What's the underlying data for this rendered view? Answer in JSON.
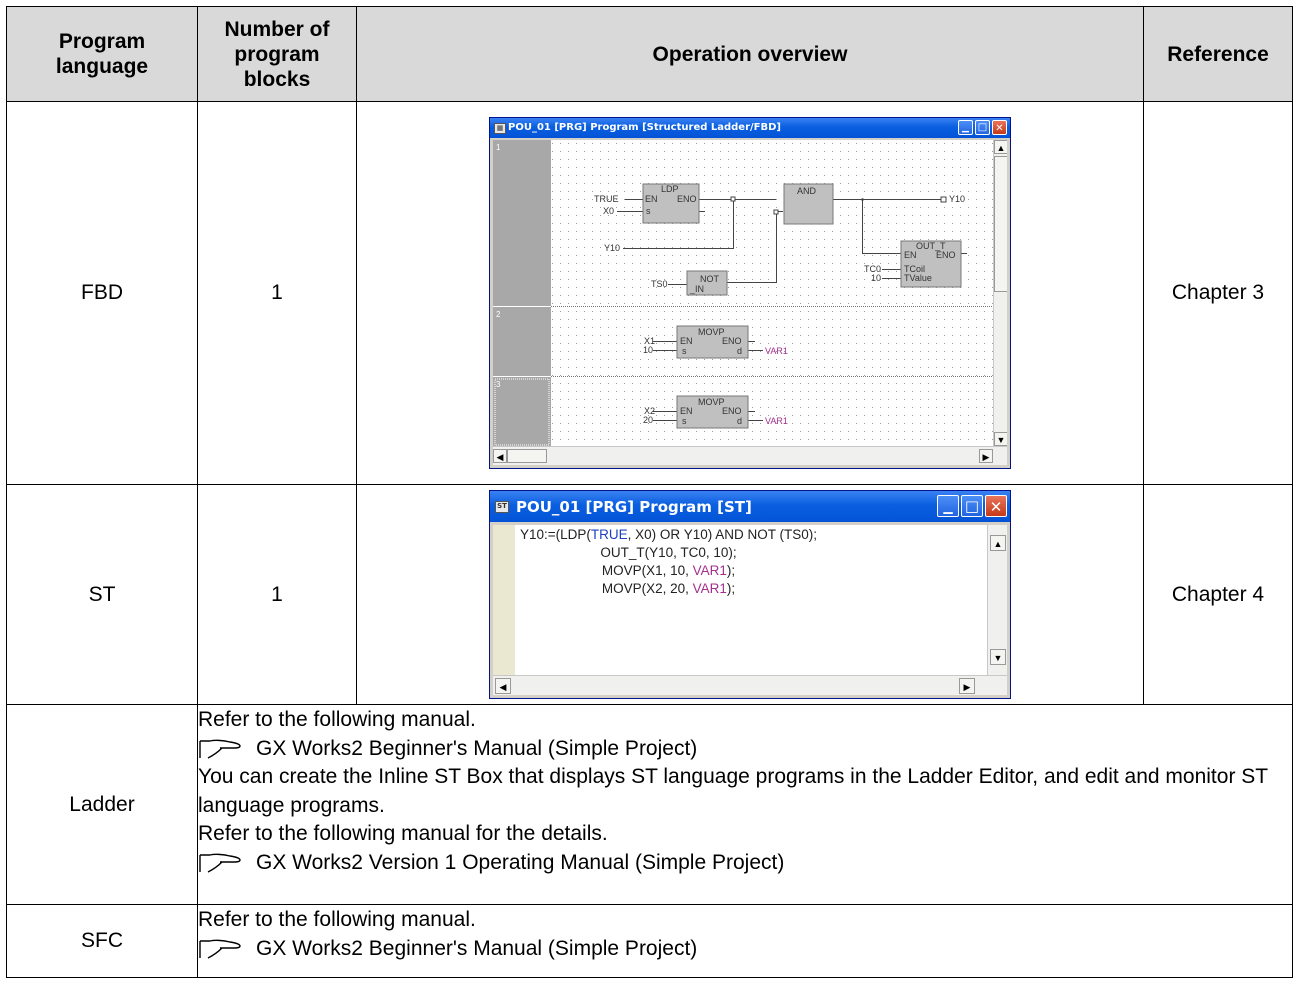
{
  "table": {
    "headers": {
      "language": "Program\nlanguage",
      "blocks": "Number of\nprogram\nblocks",
      "overview": "Operation overview",
      "reference": "Reference"
    },
    "rows": [
      {
        "language": "FBD",
        "blocks": "1",
        "reference": "Chapter 3"
      },
      {
        "language": "ST",
        "blocks": "1",
        "reference": "Chapter 4"
      },
      {
        "language": "Ladder"
      },
      {
        "language": "SFC"
      }
    ],
    "ladder_text": {
      "line1": "Refer to the following manual.",
      "ref1": "GX Works2 Beginner's Manual (Simple Project)",
      "line2": "You can create the Inline ST Box that displays ST language programs in the Ladder Editor, and edit and monitor ST language programs.",
      "line3": "Refer to the following manual for the details.",
      "ref2": "GX Works2 Version 1 Operating Manual (Simple Project)"
    },
    "sfc_text": {
      "line1": "Refer to the following manual.",
      "ref1": "GX Works2 Beginner's Manual (Simple Project)"
    }
  },
  "fbd_window": {
    "title": "POU_01 [PRG] Program [Structured Ladder/FBD]",
    "icon": "fbd-window-icon",
    "blocks": [
      "1",
      "2",
      "3"
    ],
    "labels": {
      "ldp": "LDP",
      "en": "EN",
      "eno": "ENO",
      "s": "s",
      "d": "d",
      "and": "AND",
      "not": "NOT",
      "in": "_IN",
      "out_t": "OUT_T",
      "tcoil": "TCoil",
      "tvalue": "TValue",
      "movp": "MOVP",
      "true": "TRUE",
      "x0": "X0",
      "y10": "Y10",
      "ts0": "TS0",
      "tc0": "TC0",
      "ten": "10",
      "x1": "X1",
      "x2": "X2",
      "twenty": "20",
      "var1": "VAR1"
    }
  },
  "st_window": {
    "title": "POU_01 [PRG] Program [ST]",
    "icon": "st-window-icon",
    "lines": [
      [
        "Y10:=(LDP(",
        {
          "kw": "TRUE"
        },
        ", X0) OR Y10) AND NOT (TS0);"
      ],
      [
        "OUT_T(Y10, TC0, 10);"
      ],
      [
        "MOVP(X1, 10, ",
        {
          "var": "VAR1"
        },
        ");"
      ],
      [
        "MOVP(X2, 20, ",
        {
          "var": "VAR1"
        },
        ");"
      ]
    ]
  },
  "colors": {
    "header_bg": "#d9d9d9",
    "titlebar": "#0a5fe0",
    "keyword": "#1e40c0",
    "variable": "#a3308e",
    "fbd_block": "#c0c0c0"
  }
}
